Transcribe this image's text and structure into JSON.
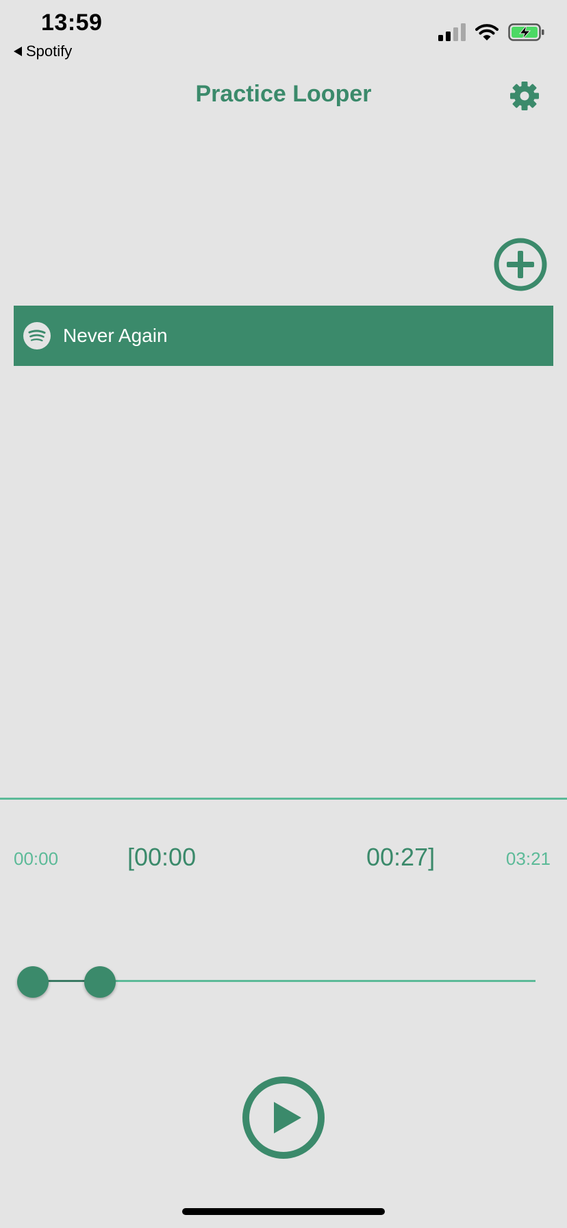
{
  "status_bar": {
    "time": "13:59",
    "back_app": "Spotify",
    "icons": [
      "cellular-signal-icon",
      "wifi-icon",
      "battery-charging-icon"
    ]
  },
  "header": {
    "title": "Practice Looper",
    "settings_icon": "gear-icon"
  },
  "add_button_icon": "plus-circle-icon",
  "tracks": [
    {
      "source_icon": "spotify-icon",
      "title": "Never Again"
    }
  ],
  "player": {
    "start_time": "00:00",
    "loop_start": "[00:00",
    "loop_end": "00:27]",
    "end_time": "03:21",
    "loop_start_fraction": 0.0,
    "loop_end_fraction": 0.134,
    "play_icon": "play-circle-icon"
  },
  "colors": {
    "accent": "#3b8a6b",
    "accent_light": "#5cba98",
    "background": "#e4e4e4"
  }
}
